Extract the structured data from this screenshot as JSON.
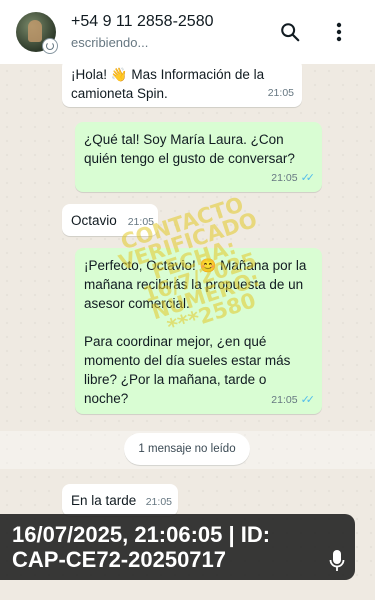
{
  "header": {
    "contact_name": "+54 9 11 2858-2580",
    "status": "escribiendo..."
  },
  "messages": [
    {
      "direction": "in",
      "text": "¡Hola! 👋 Mas Información de la camioneta Spin.",
      "time": "21:05"
    },
    {
      "direction": "out",
      "text": "¿Qué tal! Soy María Laura. ¿Con quién tengo el gusto de conversar?",
      "time": "21:05",
      "read": true
    },
    {
      "direction": "in",
      "text": "Octavio",
      "time": "21:05"
    },
    {
      "direction": "out",
      "text": "¡Perfecto, Octavio! 😊 Mañana por la mañana recibirás la propuesta de un asesor comercial.",
      "text2": "Para coordinar mejor, ¿en qué momento del día sueles estar más libre? ¿Por la mañana, tarde o noche?",
      "time": "21:05",
      "read": true
    },
    {
      "direction": "in",
      "text": "En la tarde",
      "time": "21:05"
    }
  ],
  "unread_label": "1 mensaje no leído",
  "watermark": {
    "line1": "CONTACTO",
    "line2": "VERIFICADO",
    "line3": "FECHA:",
    "line4": "16/7/2025",
    "line5": "NUMERO:",
    "line6": "***2580"
  },
  "stamp": {
    "line1": "16/07/2025, 21:06:05 | ID:",
    "line2": "CAP-CE72-20250717"
  },
  "colors": {
    "incoming_bubble": "#ffffff",
    "outgoing_bubble": "#d9fdd3",
    "chat_background": "#efeae2",
    "read_ticks": "#53bdeb",
    "watermark": "#e2c828"
  },
  "icons": {
    "search": "search-icon",
    "menu": "more-vertical-icon",
    "mic": "microphone-icon",
    "status": "status-ring-icon"
  }
}
